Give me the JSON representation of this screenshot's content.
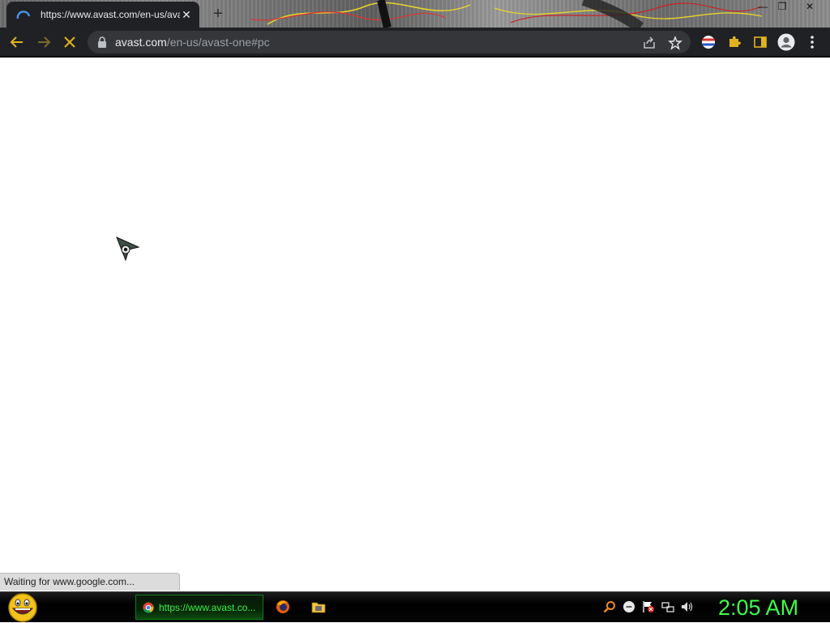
{
  "browser": {
    "tab": {
      "title": "https://www.avast.com/en-us/avast-one#pc",
      "close_label": "✕",
      "icon": "loading-spinner-icon"
    },
    "new_tab_label": "+",
    "window_controls": {
      "minimize": "—",
      "restore": "❐",
      "close": "✕"
    },
    "address_bar": {
      "host": "avast.com",
      "path": "/en-us/avast-one#pc"
    },
    "status_text": "Waiting for www.google.com..."
  },
  "taskbar": {
    "active_task_label": "https://www.avast.co...",
    "clock": "2:05 AM"
  },
  "colors": {
    "toolbar": "#202124",
    "omnibox": "#35363a",
    "clock_green": "#3cff4a",
    "task_green": "#38f048",
    "extension_yellow": "#e0b31f"
  }
}
